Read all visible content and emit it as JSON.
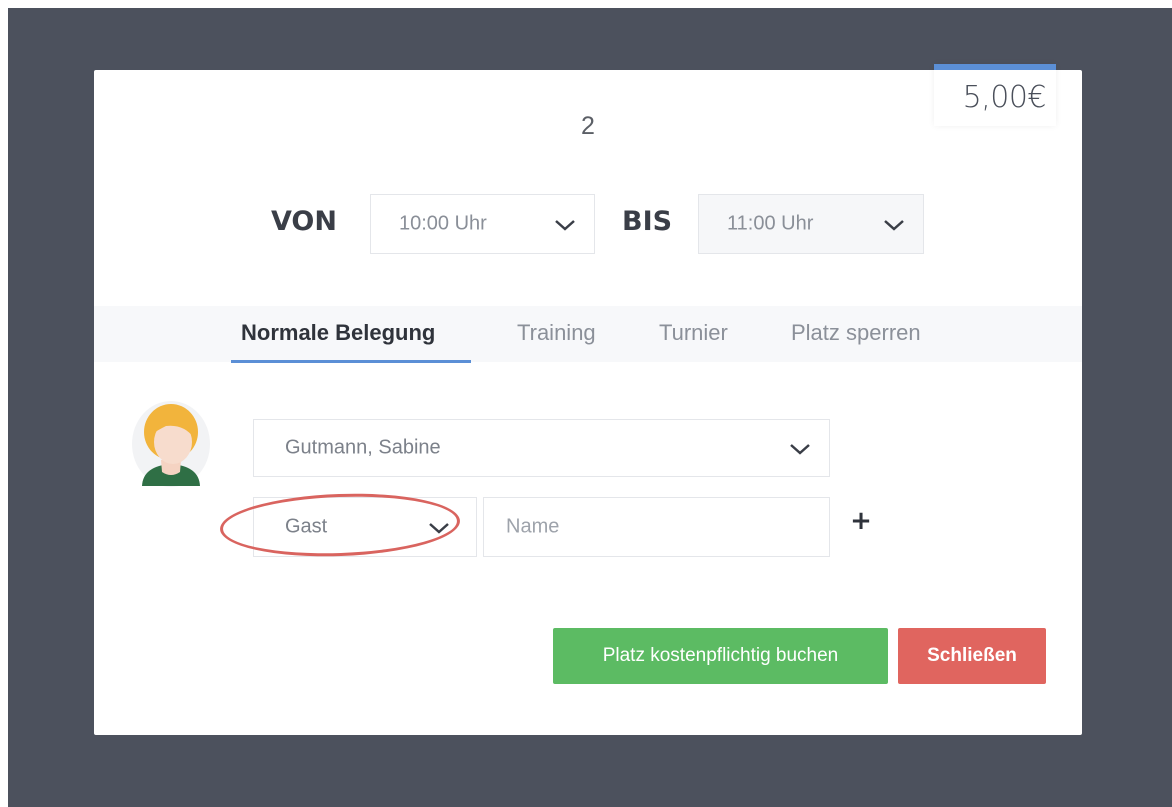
{
  "price": "5,00€",
  "court_number": "2",
  "time": {
    "from_label": "VON",
    "from_value": "10:00 Uhr",
    "to_label": "BIS",
    "to_value": "11:00 Uhr"
  },
  "tabs": [
    {
      "label": "Normale Belegung",
      "active": true
    },
    {
      "label": "Training",
      "active": false
    },
    {
      "label": "Turnier",
      "active": false
    },
    {
      "label": "Platz sperren",
      "active": false
    }
  ],
  "booking": {
    "player_value": "Gutmann, Sabine",
    "guest_type_value": "Gast",
    "name_placeholder": "Name",
    "add_symbol": "+"
  },
  "buttons": {
    "book_label": "Platz kostenpflichtig buchen",
    "close_label": "Schließen"
  },
  "colors": {
    "accent_blue": "#5b8fd6",
    "book_green": "#5cbb63",
    "close_red": "#e0655f",
    "annotation_red": "#d9645f",
    "backdrop": "#4c515d"
  }
}
